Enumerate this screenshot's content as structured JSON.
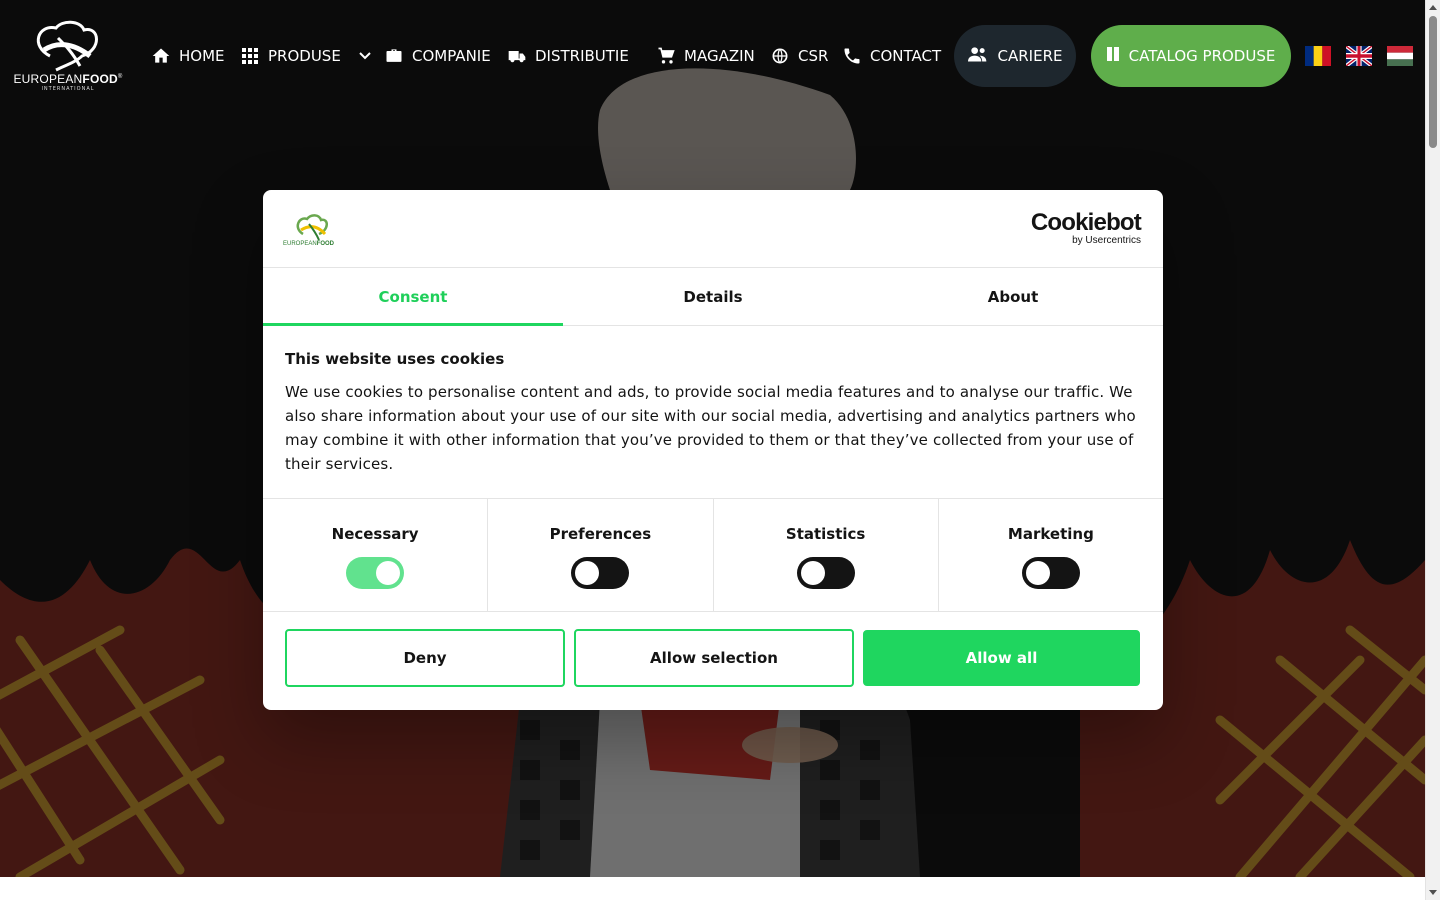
{
  "brand": {
    "logo_text_light": "EUROPEAN",
    "logo_text_bold": "FOOD",
    "logo_mark": "®",
    "logo_sub": "INTERNATIONAL"
  },
  "nav": {
    "home": "HOME",
    "produse": "PRODUSE",
    "companie": "COMPANIE",
    "distributie": "DISTRIBUTIE",
    "magazin": "MAGAZIN",
    "csr": "CSR",
    "contact": "CONTACT",
    "cariere": "CARIERE",
    "catalog": "CATALOG PRODUSE"
  },
  "languages": [
    "ro",
    "en",
    "hu"
  ],
  "cookie_dialog": {
    "provider_name": "Cookiebot",
    "provider_by": "by Usercentrics",
    "tabs": [
      {
        "label": "Consent",
        "active": true
      },
      {
        "label": "Details",
        "active": false
      },
      {
        "label": "About",
        "active": false
      }
    ],
    "title": "This website uses cookies",
    "body": "We use cookies to personalise content and ads, to provide social media features and to analyse our traffic. We also share information about your use of our site with our social media, advertising and analytics partners who may combine it with other information that you’ve provided to them or that they’ve collected from your use of their services.",
    "categories": [
      {
        "label": "Necessary",
        "enabled": true
      },
      {
        "label": "Preferences",
        "enabled": false
      },
      {
        "label": "Statistics",
        "enabled": false
      },
      {
        "label": "Marketing",
        "enabled": false
      }
    ],
    "buttons": {
      "deny": "Deny",
      "allow_selection": "Allow selection",
      "allow_all": "Allow all"
    }
  },
  "colors": {
    "accent_green": "#1fd65f",
    "nav_pill_dark": "#1e272e",
    "nav_pill_green": "#5fae4b",
    "flame_red": "#7a2a22",
    "grid_gold": "#b78a2c"
  }
}
